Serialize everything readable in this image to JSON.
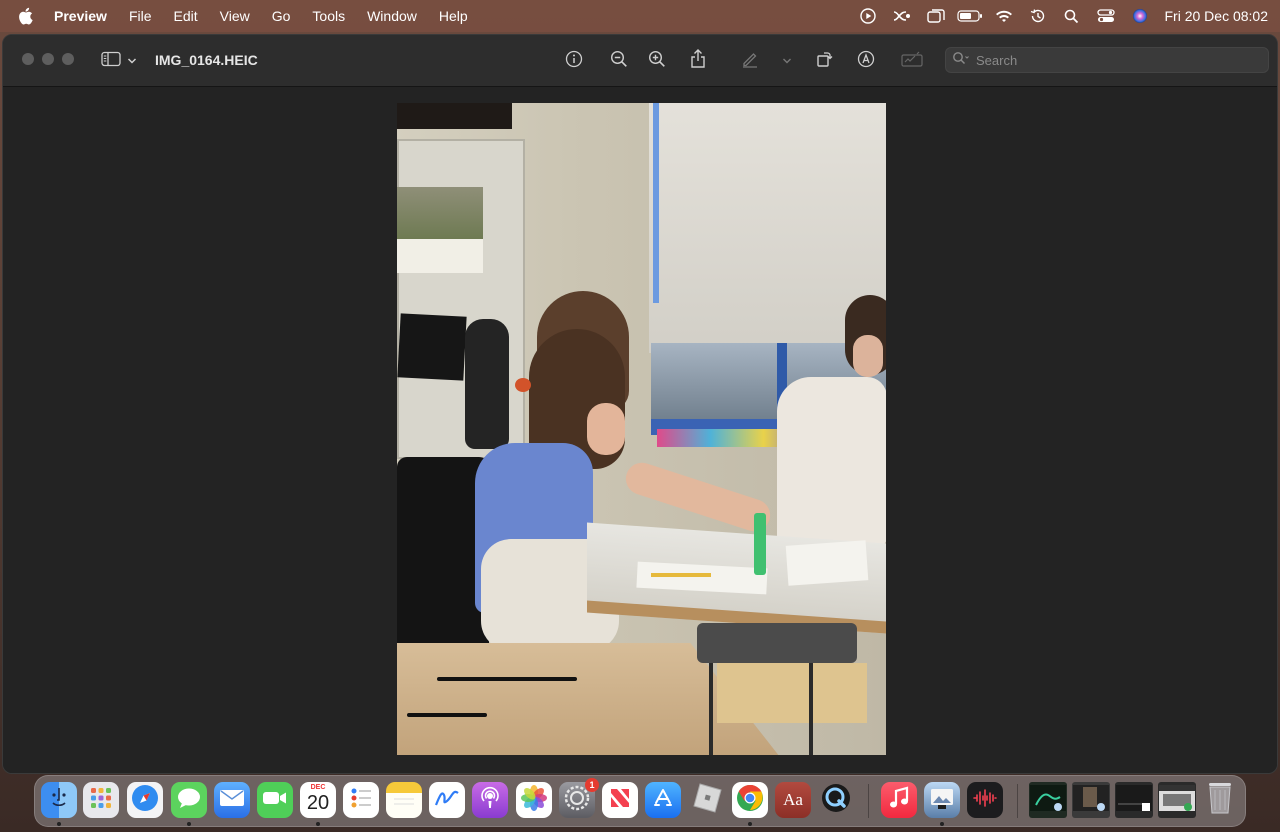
{
  "menubar": {
    "app_name": "Preview",
    "items": [
      "File",
      "Edit",
      "View",
      "Go",
      "Tools",
      "Window",
      "Help"
    ],
    "clock": "Fri 20 Dec  08:02",
    "status_icons": [
      "play-icon",
      "stage-manager-icon",
      "window-icon",
      "battery-icon",
      "wifi-icon",
      "time-machine-icon",
      "spotlight-icon",
      "control-center-icon",
      "siri-icon"
    ]
  },
  "window": {
    "title": "IMG_0164.HEIC",
    "search": {
      "placeholder": "Search",
      "value": ""
    },
    "toolbar": [
      "info-icon",
      "zoom-out-icon",
      "zoom-in-icon",
      "share-icon",
      "markup-pen-icon",
      "chevron-down-icon",
      "rotate-icon",
      "annotate-icon",
      "signature-icon"
    ]
  },
  "dock": {
    "apps": [
      "Finder",
      "Launchpad",
      "Safari",
      "Messages",
      "Mail",
      "FaceTime",
      "Calendar",
      "Reminders",
      "Notes",
      "Freeform",
      "Podcasts",
      "Photos",
      "System Settings",
      "News",
      "App Store",
      "Roblox",
      "Chrome",
      "Dictionary",
      "QuickTime Player",
      "Music",
      "Preview",
      "Voice Memos",
      "Trash"
    ],
    "calendar": {
      "month": "DEC",
      "day": "20"
    },
    "settings_badge": "1",
    "dictionary_label": "Aa"
  },
  "colors": {
    "menubar": "#784e40",
    "window_bg": "#252525",
    "accent_blue": "#2f7cf6"
  }
}
